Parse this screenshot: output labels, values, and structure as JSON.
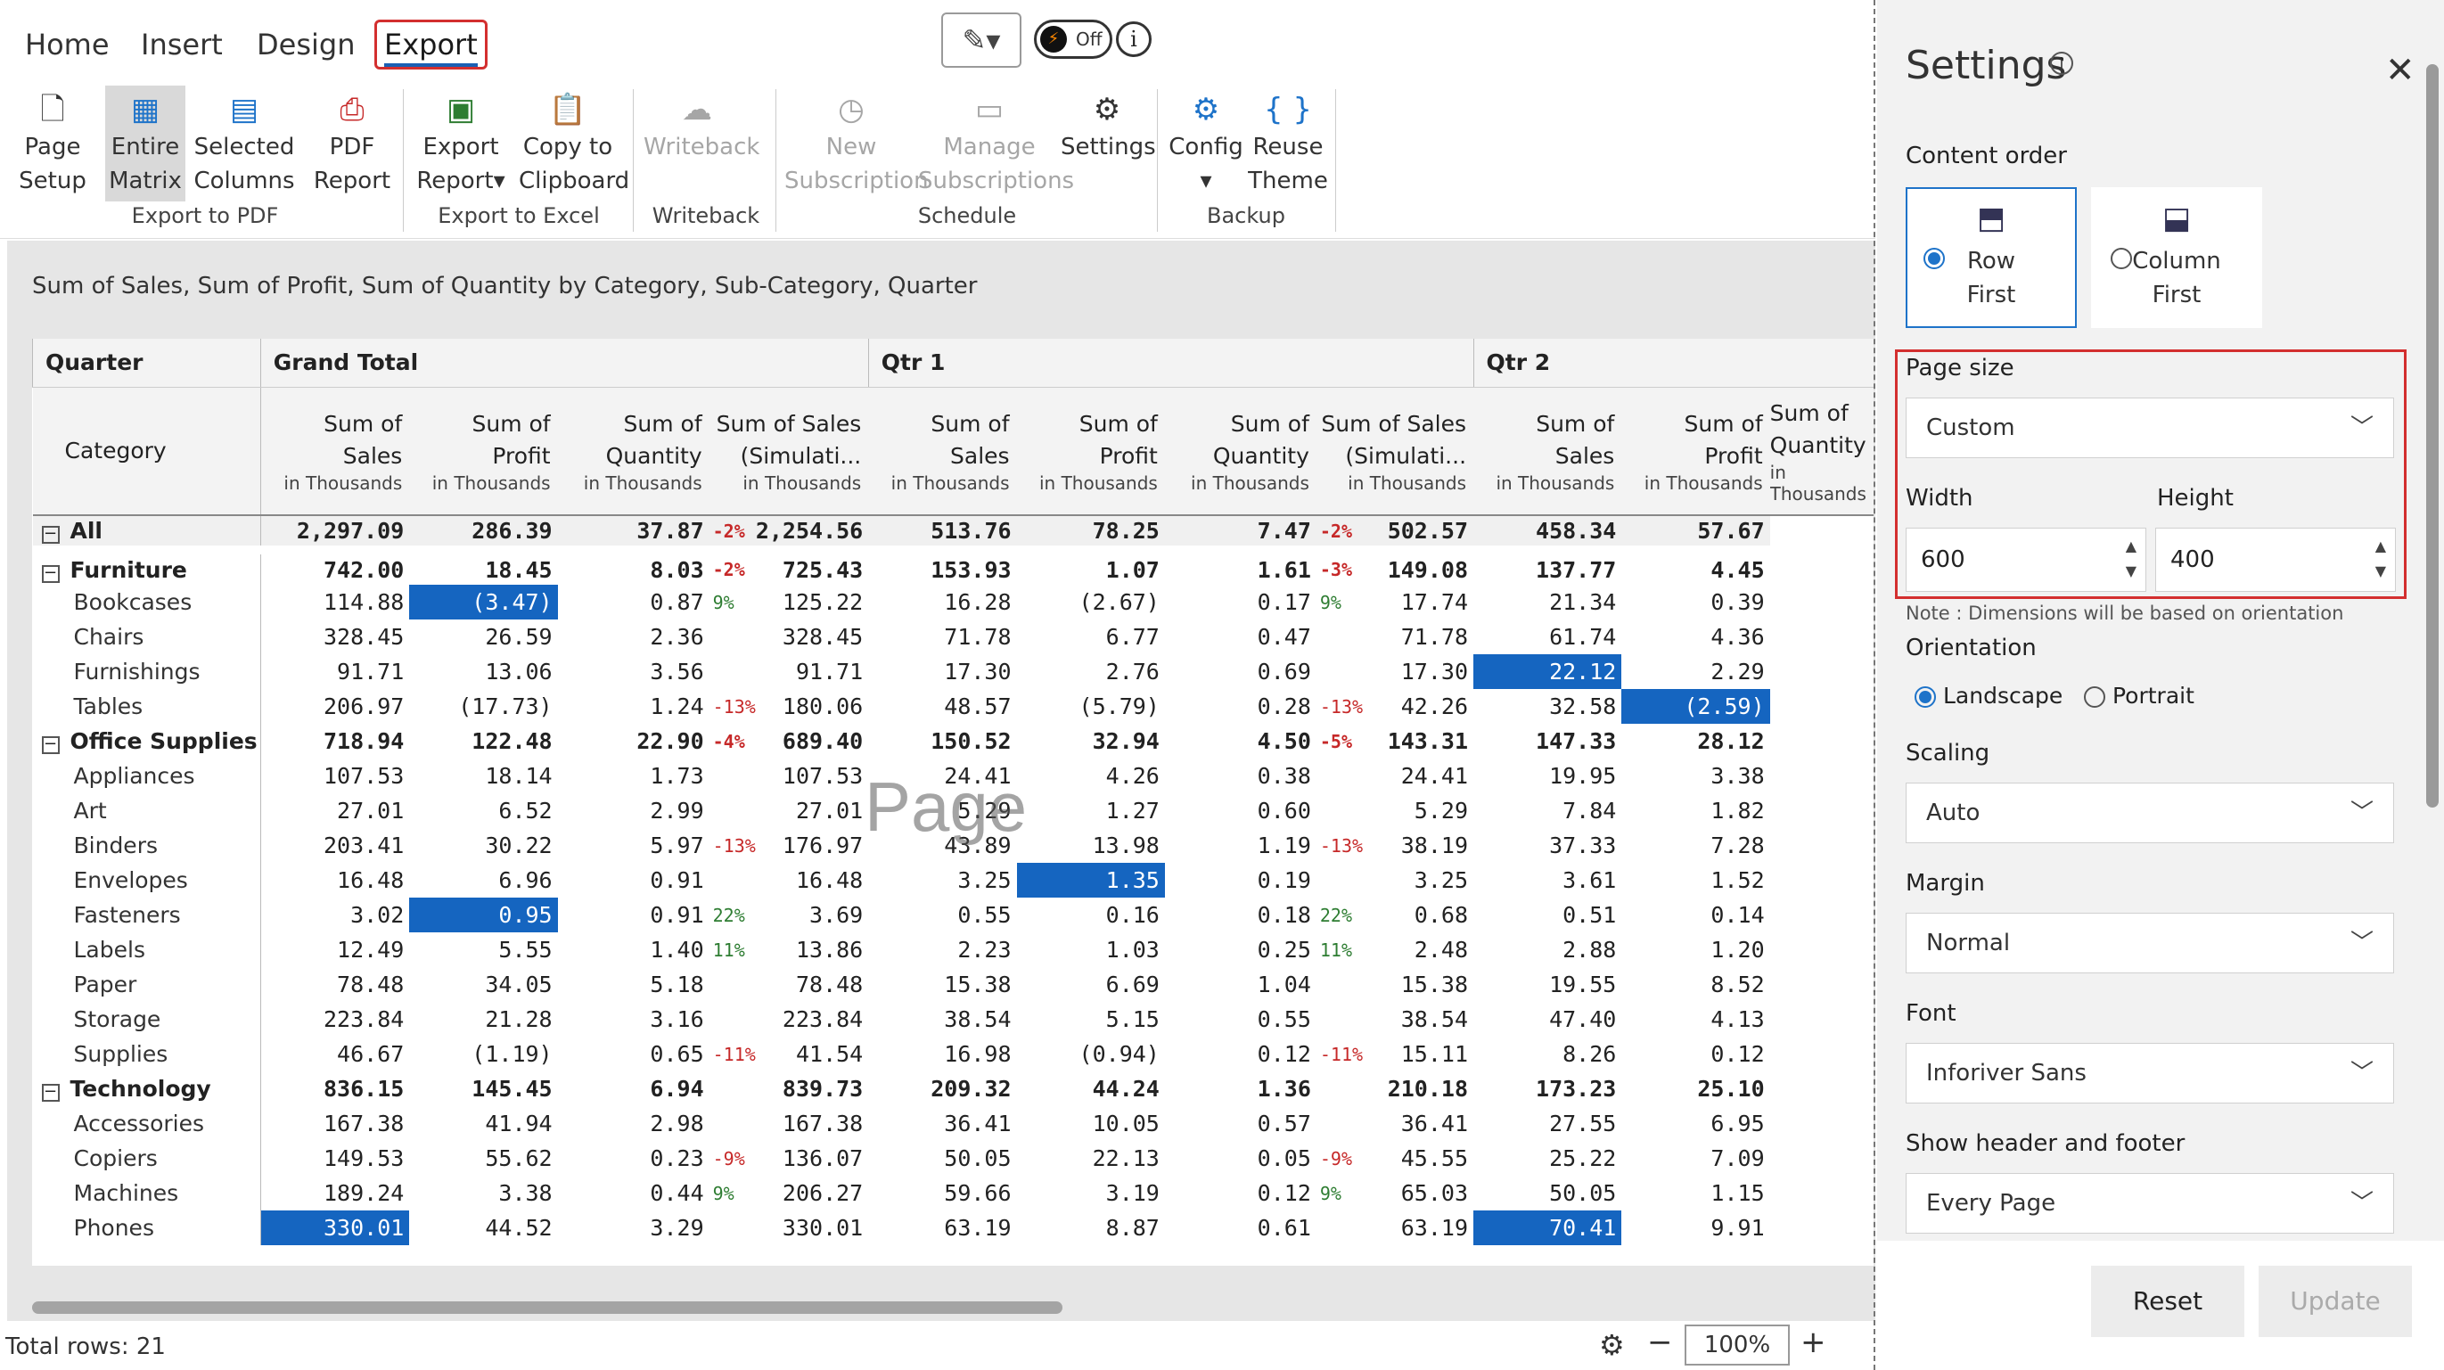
{
  "menu": {
    "home": "Home",
    "insert": "Insert",
    "design": "Design",
    "export": "Export",
    "toggle": "Off"
  },
  "ribbon": {
    "page_setup": [
      "Page",
      "Setup"
    ],
    "entire_matrix": [
      "Entire",
      "Matrix"
    ],
    "selected_columns": [
      "Selected",
      "Columns"
    ],
    "pdf_report": [
      "PDF",
      "Report"
    ],
    "export_report": [
      "Export",
      "Report"
    ],
    "copy_clipboard": [
      "Copy to",
      "Clipboard"
    ],
    "writeback": "Writeback",
    "new_sub": [
      "New",
      "Subscription"
    ],
    "manage_sub": [
      "Manage",
      "Subscriptions"
    ],
    "settings": "Settings",
    "config": "Config",
    "reuse_theme": [
      "Reuse",
      "Theme"
    ],
    "groups": {
      "export_pdf": "Export to PDF",
      "export_excel": "Export to Excel",
      "writeback": "Writeback",
      "schedule": "Schedule",
      "backup": "Backup"
    }
  },
  "report": {
    "title": "Sum of Sales, Sum of Profit, Sum of Quantity by Category, Sub-Category, Quarter",
    "watermark": "Page",
    "row_header": "Quarter",
    "category_header": "Category",
    "groups": [
      "Grand Total",
      "Qtr 1",
      "Qtr 2"
    ],
    "measure_unit": "in Thousands",
    "measures": [
      "Sum of Sales",
      "Sum of Profit",
      "Sum of Quantity",
      "Sum of Sales (Simulati..."
    ],
    "rows": [
      {
        "label": "All",
        "level": 0,
        "vals": [
          "2,297.09",
          "286.39",
          "37.87",
          "-2%",
          "2,254.56",
          "513.76",
          "78.25",
          "7.47",
          "-2%",
          "502.57",
          "458.34",
          "57.67"
        ]
      },
      {
        "label": "Furniture",
        "level": 0,
        "vals": [
          "742.00",
          "18.45",
          "8.03",
          "-2%",
          "725.43",
          "153.93",
          "1.07",
          "1.61",
          "-3%",
          "149.08",
          "137.77",
          "4.45"
        ]
      },
      {
        "label": "Bookcases",
        "level": 1,
        "vals": [
          "114.88",
          "(3.47)",
          "0.87",
          "9%",
          "125.22",
          "16.28",
          "(2.67)",
          "0.17",
          "9%",
          "17.74",
          "21.34",
          "0.39"
        ],
        "hl": [
          1
        ]
      },
      {
        "label": "Chairs",
        "level": 1,
        "vals": [
          "328.45",
          "26.59",
          "2.36",
          "",
          "328.45",
          "71.78",
          "6.77",
          "0.47",
          "",
          "71.78",
          "61.74",
          "4.36"
        ]
      },
      {
        "label": "Furnishings",
        "level": 1,
        "vals": [
          "91.71",
          "13.06",
          "3.56",
          "",
          "91.71",
          "17.30",
          "2.76",
          "0.69",
          "",
          "17.30",
          "22.12",
          "2.29"
        ],
        "hl": [
          10
        ]
      },
      {
        "label": "Tables",
        "level": 1,
        "vals": [
          "206.97",
          "(17.73)",
          "1.24",
          "-13%",
          "180.06",
          "48.57",
          "(5.79)",
          "0.28",
          "-13%",
          "42.26",
          "32.58",
          "(2.59)"
        ],
        "hl": [
          11
        ]
      },
      {
        "label": "Office Supplies",
        "level": 0,
        "vals": [
          "718.94",
          "122.48",
          "22.90",
          "-4%",
          "689.40",
          "150.52",
          "32.94",
          "4.50",
          "-5%",
          "143.31",
          "147.33",
          "28.12"
        ]
      },
      {
        "label": "Appliances",
        "level": 1,
        "vals": [
          "107.53",
          "18.14",
          "1.73",
          "",
          "107.53",
          "24.41",
          "4.26",
          "0.38",
          "",
          "24.41",
          "19.95",
          "3.38"
        ]
      },
      {
        "label": "Art",
        "level": 1,
        "vals": [
          "27.01",
          "6.52",
          "2.99",
          "",
          "27.01",
          "5.29",
          "1.27",
          "0.60",
          "",
          "5.29",
          "7.84",
          "1.82"
        ]
      },
      {
        "label": "Binders",
        "level": 1,
        "vals": [
          "203.41",
          "30.22",
          "5.97",
          "-13%",
          "176.97",
          "43.89",
          "13.98",
          "1.19",
          "-13%",
          "38.19",
          "37.33",
          "7.28"
        ]
      },
      {
        "label": "Envelopes",
        "level": 1,
        "vals": [
          "16.48",
          "6.96",
          "0.91",
          "",
          "16.48",
          "3.25",
          "1.35",
          "0.19",
          "",
          "3.25",
          "3.61",
          "1.52"
        ],
        "hl": [
          6
        ]
      },
      {
        "label": "Fasteners",
        "level": 1,
        "vals": [
          "3.02",
          "0.95",
          "0.91",
          "22%",
          "3.69",
          "0.55",
          "0.16",
          "0.18",
          "22%",
          "0.68",
          "0.51",
          "0.14"
        ],
        "hl": [
          1
        ]
      },
      {
        "label": "Labels",
        "level": 1,
        "vals": [
          "12.49",
          "5.55",
          "1.40",
          "11%",
          "13.86",
          "2.23",
          "1.03",
          "0.25",
          "11%",
          "2.48",
          "2.88",
          "1.20"
        ]
      },
      {
        "label": "Paper",
        "level": 1,
        "vals": [
          "78.48",
          "34.05",
          "5.18",
          "",
          "78.48",
          "15.38",
          "6.69",
          "1.04",
          "",
          "15.38",
          "19.55",
          "8.52"
        ]
      },
      {
        "label": "Storage",
        "level": 1,
        "vals": [
          "223.84",
          "21.28",
          "3.16",
          "",
          "223.84",
          "38.54",
          "5.15",
          "0.55",
          "",
          "38.54",
          "47.40",
          "4.13"
        ]
      },
      {
        "label": "Supplies",
        "level": 1,
        "vals": [
          "46.67",
          "(1.19)",
          "0.65",
          "-11%",
          "41.54",
          "16.98",
          "(0.94)",
          "0.12",
          "-11%",
          "15.11",
          "8.26",
          "0.12"
        ]
      },
      {
        "label": "Technology",
        "level": 0,
        "vals": [
          "836.15",
          "145.45",
          "6.94",
          "",
          "839.73",
          "209.32",
          "44.24",
          "1.36",
          "",
          "210.18",
          "173.23",
          "25.10"
        ]
      },
      {
        "label": "Accessories",
        "level": 1,
        "vals": [
          "167.38",
          "41.94",
          "2.98",
          "",
          "167.38",
          "36.41",
          "10.05",
          "0.57",
          "",
          "36.41",
          "27.55",
          "6.95"
        ]
      },
      {
        "label": "Copiers",
        "level": 1,
        "vals": [
          "149.53",
          "55.62",
          "0.23",
          "-9%",
          "136.07",
          "50.05",
          "22.13",
          "0.05",
          "-9%",
          "45.55",
          "25.22",
          "7.09"
        ]
      },
      {
        "label": "Machines",
        "level": 1,
        "vals": [
          "189.24",
          "3.38",
          "0.44",
          "9%",
          "206.27",
          "59.66",
          "3.19",
          "0.12",
          "9%",
          "65.03",
          "50.05",
          "1.15"
        ]
      },
      {
        "label": "Phones",
        "level": 1,
        "vals": [
          "330.01",
          "44.52",
          "3.29",
          "",
          "330.01",
          "63.19",
          "8.87",
          "0.61",
          "",
          "63.19",
          "70.41",
          "9.91"
        ],
        "hl": [
          0,
          10
        ]
      }
    ]
  },
  "status": {
    "total_rows": "Total rows: 21",
    "zoom": "100%"
  },
  "panel": {
    "title": "Settings",
    "content_order": "Content order",
    "row_first": [
      "Row",
      "First"
    ],
    "column_first": [
      "Column",
      "First"
    ],
    "page_size": "Page size",
    "page_size_value": "Custom",
    "width_label": "Width",
    "height_label": "Height",
    "width": "600",
    "height": "400",
    "note": "Note : Dimensions will be based on orientation",
    "orientation": "Orientation",
    "landscape": "Landscape",
    "portrait": "Portrait",
    "scaling": "Scaling",
    "scaling_value": "Auto",
    "margin": "Margin",
    "margin_value": "Normal",
    "font": "Font",
    "font_value": "Inforiver Sans",
    "header_footer": "Show header and footer",
    "header_footer_value": "Every Page",
    "reset": "Reset",
    "update": "Update"
  },
  "colors": {
    "accent": "#1e73c9",
    "highlight": "#1565c0",
    "negative": "#c62828",
    "positive": "#2e7d32",
    "callout": "#d32f2f"
  }
}
